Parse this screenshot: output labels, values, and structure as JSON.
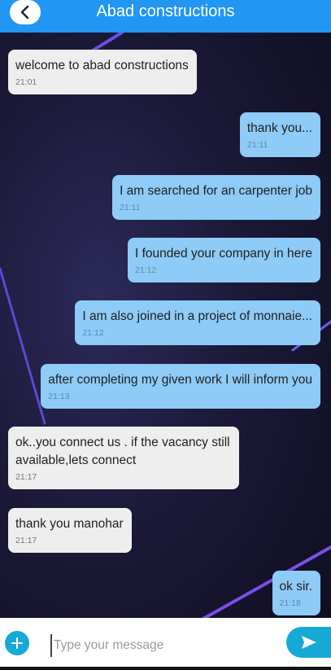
{
  "header": {
    "title": "Abad constructions",
    "color": "#2196f3"
  },
  "messages": [
    {
      "text": "welcome to abad constructions",
      "time": "21:01",
      "direction": "in"
    },
    {
      "text": "thank you...",
      "time": "21:11",
      "direction": "out"
    },
    {
      "text": "I am searched for an carpenter job",
      "time": "21:11",
      "direction": "out"
    },
    {
      "text": "I founded your company in here",
      "time": "21:12",
      "direction": "out"
    },
    {
      "text": "I am also joined in a project of monnaie...",
      "time": "21:12",
      "direction": "out"
    },
    {
      "text": "after completing my given work I will inform you",
      "time": "21:13",
      "direction": "out"
    },
    {
      "text": "ok..you connect us . if the vacancy still available,lets connect",
      "time": "21:17",
      "direction": "in"
    },
    {
      "text": "thank you manohar",
      "time": "21:17",
      "direction": "in"
    },
    {
      "text": "ok sir.",
      "time": "21:18",
      "direction": "out"
    }
  ],
  "composer": {
    "placeholder": "Type your message",
    "value": "",
    "accent": "#17a9d6"
  },
  "icons": {
    "back": "chevron-left-icon",
    "add": "plus-icon",
    "send": "send-icon"
  }
}
